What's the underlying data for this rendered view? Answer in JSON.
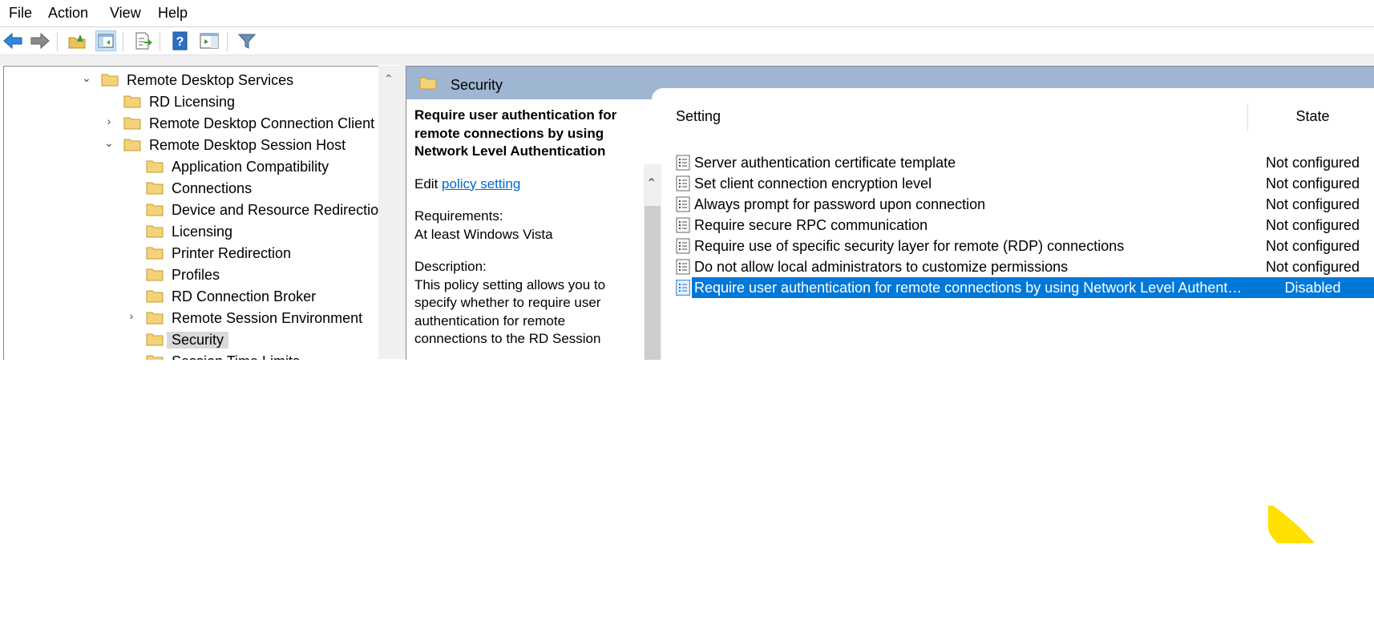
{
  "menu": [
    "File",
    "Action",
    "View",
    "Help"
  ],
  "toolbar": {
    "buttons": [
      "back-arrow-icon",
      "forward-arrow-icon",
      "up-folder-icon",
      "show-hide-console-tree-icon",
      "export-list-icon",
      "help-icon",
      "show-action-pane-icon",
      "filter-icon"
    ]
  },
  "tree": {
    "items": [
      {
        "label": "Remote Desktop Services",
        "expander": "expanded",
        "level": 0
      },
      {
        "label": "RD Licensing",
        "expander": "none",
        "level": 1
      },
      {
        "label": "Remote Desktop Connection Client",
        "expander": "collapsed",
        "level": 1
      },
      {
        "label": "Remote Desktop Session Host",
        "expander": "expanded",
        "level": 1
      },
      {
        "label": "Application Compatibility",
        "expander": "none",
        "level": 2
      },
      {
        "label": "Connections",
        "expander": "none",
        "level": 2
      },
      {
        "label": "Device and Resource Redirection",
        "expander": "none",
        "level": 2
      },
      {
        "label": "Licensing",
        "expander": "none",
        "level": 2
      },
      {
        "label": "Printer Redirection",
        "expander": "none",
        "level": 2
      },
      {
        "label": "Profiles",
        "expander": "none",
        "level": 2
      },
      {
        "label": "RD Connection Broker",
        "expander": "none",
        "level": 2
      },
      {
        "label": "Remote Session Environment",
        "expander": "collapsed",
        "level": 2
      },
      {
        "label": "Security",
        "expander": "none",
        "level": 2,
        "selected": true
      },
      {
        "label": "Session Time Limits",
        "expander": "none",
        "level": 2
      }
    ]
  },
  "panel": {
    "title": "Security"
  },
  "description": {
    "heading": "Require user authentication for remote connections by using Network Level Authentication",
    "edit_prefix": "Edit ",
    "edit_link": "policy setting ",
    "requirements_label": "Requirements:",
    "requirements_value": "At least Windows Vista",
    "description_label": "Description:",
    "description_text": "This policy setting allows you to specify whether to require user authentication for remote connections to the RD Session"
  },
  "list": {
    "columns": {
      "setting": "Setting",
      "state": "State"
    },
    "rows": [
      {
        "setting": "Server authentication certificate template",
        "state": "Not configured"
      },
      {
        "setting": "Set client connection encryption level",
        "state": "Not configured"
      },
      {
        "setting": "Always prompt for password upon connection",
        "state": "Not configured"
      },
      {
        "setting": "Require secure RPC communication",
        "state": "Not configured"
      },
      {
        "setting": "Require use of specific security layer for remote (RDP) connections",
        "state": "Not configured"
      },
      {
        "setting": "Do not allow local administrators to customize permissions",
        "state": "Not configured"
      },
      {
        "setting": "Require user authentication for remote connections by using Network Level Authentication",
        "state": "Disabled",
        "selected": true
      }
    ]
  },
  "colors": {
    "selection": "#0078d7",
    "header_band": "#9fb6d3",
    "link": "#0066cc",
    "folder": "#e8c35c"
  }
}
